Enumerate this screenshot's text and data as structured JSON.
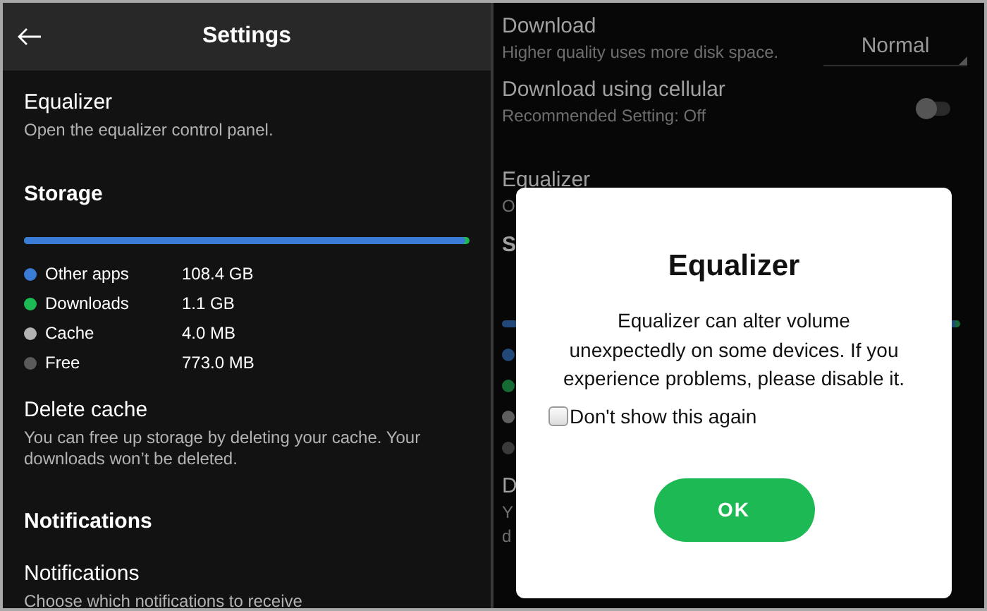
{
  "left_screen": {
    "header": {
      "title": "Settings"
    },
    "equalizer": {
      "title": "Equalizer",
      "subtitle": "Open the equalizer control panel."
    },
    "storage": {
      "heading": "Storage",
      "usage_bar": {
        "level": 0.99
      },
      "legend": [
        {
          "label": "Other apps",
          "value": "108.4 GB",
          "color": "#3a7bd5"
        },
        {
          "label": "Downloads",
          "value": "1.1 GB",
          "color": "#1db954"
        },
        {
          "label": "Cache",
          "value": "4.0 MB",
          "color": "#b3b3b3"
        },
        {
          "label": "Free",
          "value": "773.0 MB",
          "color": "#5a5a5a"
        }
      ]
    },
    "delete_cache": {
      "title": "Delete cache",
      "subtitle": "You can free up storage by deleting your cache. Your downloads won’t be deleted."
    },
    "notifications": {
      "heading": "Notifications",
      "title": "Notifications",
      "subtitle": "Choose which notifications to receive"
    }
  },
  "right_screen": {
    "download": {
      "title": "Download",
      "subtitle": "Higher quality uses more disk space.",
      "quality": "Normal"
    },
    "cellular": {
      "title": "Download using cellular",
      "subtitle": "Recommended Setting: Off",
      "on": false
    },
    "equalizer": {
      "title": "Equalizer",
      "subtitle": "O"
    },
    "storage_heading": "S",
    "storage_dots": [
      {
        "color": "#22487a"
      },
      {
        "color": "#156b33"
      },
      {
        "color": "#5e5e5e"
      },
      {
        "color": "#3a3a3a"
      }
    ],
    "delete_cache": {
      "title": "D",
      "line_1": "Y",
      "line_2": "d"
    },
    "dialog": {
      "title": "Equalizer",
      "message": "Equalizer can alter volume unexpectedly on some devices. If you experience problems, please disable it.",
      "checkbox": {
        "label": "Don't show this again",
        "checked": false
      },
      "ok_button": "OK"
    }
  }
}
